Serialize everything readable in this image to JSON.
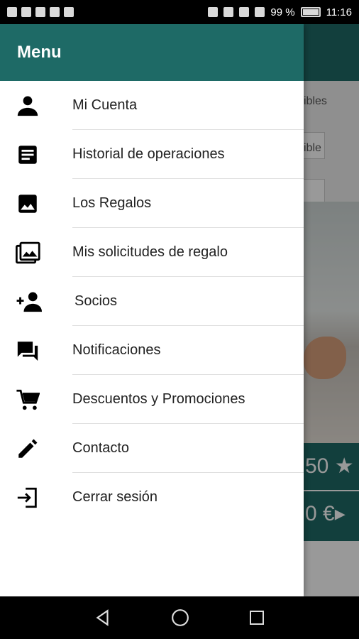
{
  "status_bar": {
    "battery": "99 %",
    "time": "11:16"
  },
  "drawer": {
    "title": "Menu",
    "items": [
      {
        "label": "Mi Cuenta",
        "icon": "person-icon"
      },
      {
        "label": "Historial de operaciones",
        "icon": "document-icon"
      },
      {
        "label": "Los Regalos",
        "icon": "image-icon"
      },
      {
        "label": "Mis solicitudes de regalo",
        "icon": "images-icon"
      },
      {
        "label": "Socios",
        "icon": "add-person-icon"
      },
      {
        "label": "Notificaciones",
        "icon": "chat-icon"
      },
      {
        "label": "Descuentos y Promociones",
        "icon": "cart-icon"
      },
      {
        "label": "Contacto",
        "icon": "pencil-icon"
      },
      {
        "label": "Cerrar sesión",
        "icon": "logout-icon"
      }
    ]
  },
  "background": {
    "text1": "ibles",
    "text2": "ible",
    "value1": "50 ★",
    "value2": "0 €▸"
  },
  "colors": {
    "primary": "#1e6a66"
  }
}
